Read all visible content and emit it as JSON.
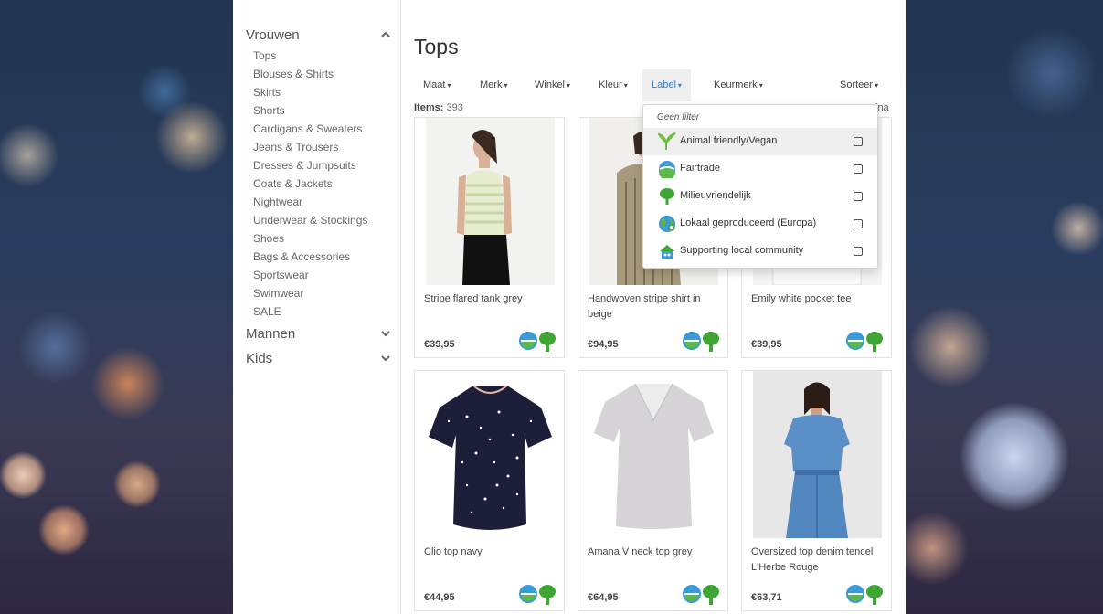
{
  "sidebar": {
    "categories": [
      {
        "label": "Vrouwen",
        "expanded": true,
        "items": [
          "Tops",
          "Blouses & Shirts",
          "Skirts",
          "Shorts",
          "Cardigans & Sweaters",
          "Jeans & Trousers",
          "Dresses & Jumpsuits",
          "Coats & Jackets",
          "Nightwear",
          "Underwear & Stockings",
          "Shoes",
          "Bags & Accessories",
          "Sportswear",
          "Swimwear",
          "SALE"
        ]
      },
      {
        "label": "Mannen",
        "expanded": false
      },
      {
        "label": "Kids",
        "expanded": false
      }
    ]
  },
  "main": {
    "title": "Tops",
    "filters": [
      "Maat",
      "Merk",
      "Winkel",
      "Kleur",
      "Label",
      "Keurmerk",
      "Sorteer"
    ],
    "active_filter": "Label",
    "items_label": "Items:",
    "items_count": "393",
    "cut_text": "ina"
  },
  "label_dropdown": {
    "header": "Geen filter",
    "options": [
      {
        "label": "Animal friendly/Vegan",
        "icon": "sprout-icon",
        "hovered": true
      },
      {
        "label": "Fairtrade",
        "icon": "fairtrade-icon"
      },
      {
        "label": "Milieuvriendelijk",
        "icon": "tree-icon"
      },
      {
        "label": "Lokaal geproduceerd (Europa)",
        "icon": "globe-icon"
      },
      {
        "label": "Supporting local community",
        "icon": "community-icon"
      }
    ]
  },
  "products": [
    {
      "name": "Stripe flared tank grey",
      "price": "€39,95"
    },
    {
      "name": "Handwoven stripe shirt in beige",
      "price": "€94,95"
    },
    {
      "name": "Emily white pocket tee",
      "price": "€39,95"
    },
    {
      "name": "Clio top navy",
      "price": "€44,95"
    },
    {
      "name": "Amana V neck top grey",
      "price": "€64,95"
    },
    {
      "name": "Oversized top denim tencel L'Herbe Rouge",
      "price": "€63,71"
    }
  ],
  "colors": {
    "accent": "#3a7bbf",
    "eco_green": "#3fa535",
    "fairtrade_blue": "#3b9ad8"
  }
}
